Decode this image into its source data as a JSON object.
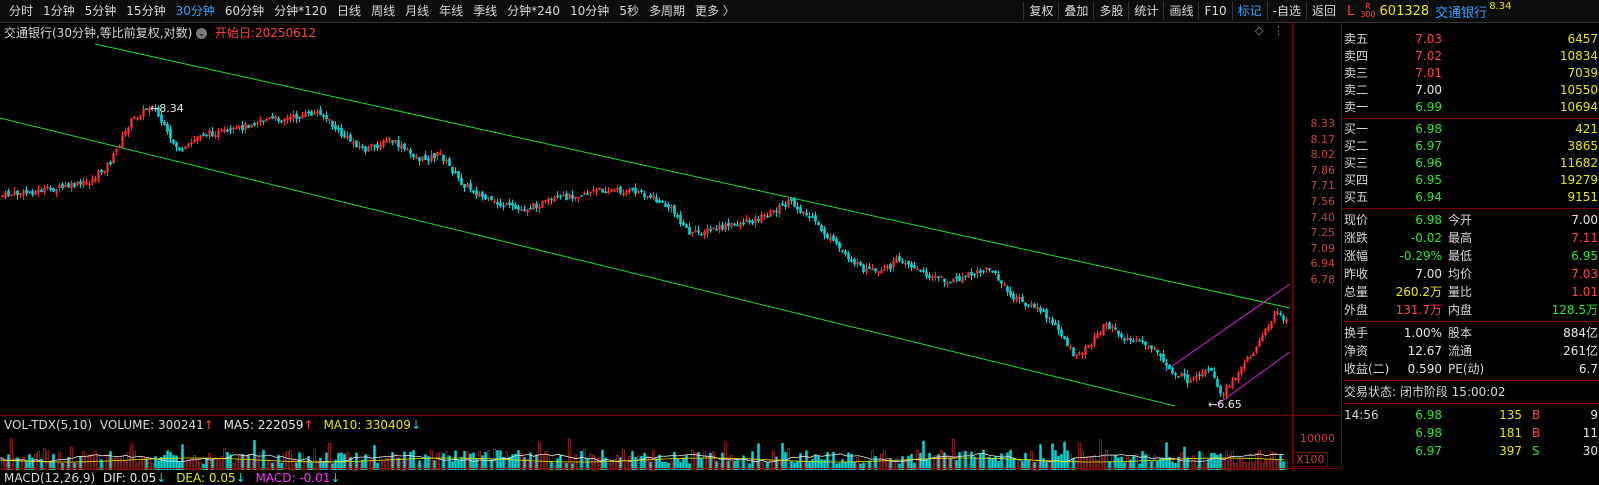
{
  "toolbar": {
    "periods": [
      "分时",
      "1分钟",
      "5分钟",
      "15分钟",
      "30分钟",
      "60分钟",
      "分钟*120",
      "日线",
      "周线",
      "月线",
      "年线",
      "季线",
      "分钟*240",
      "10分钟",
      "5秒",
      "多周期",
      "更多 〉"
    ],
    "active_period": "30分钟",
    "right_buttons": [
      "复权",
      "叠加",
      "多股",
      "统计",
      "画线",
      "F10",
      "标记",
      "-自选",
      "返回"
    ],
    "marked_button": "标记"
  },
  "stock": {
    "market_tag": "L",
    "r300": "R\n300",
    "code": "601328",
    "name": "交通银行",
    "price_small": "8.34"
  },
  "chart": {
    "title": "交通银行(30分钟,等比前复权,对数)",
    "start_label": "开始日:20250612",
    "y_ticks": [
      "8.33",
      "8.17",
      "8.02",
      "7.86",
      "7.71",
      "7.56",
      "7.40",
      "7.25",
      "7.09",
      "6.94",
      "6.78"
    ],
    "high_label": "8.34",
    "low_label": "6.65",
    "colors": {
      "up": "#ff3030",
      "down": "#00d8d8",
      "channel": "#22dd22",
      "channel2": "#dd22dd",
      "ma5": "#e8e8e8",
      "ma10": "#e8e800"
    }
  },
  "volume": {
    "indicator": "VOL-TDX(5,10)",
    "volume_label": "VOLUME: 300241",
    "ma5_label": "MA5: 222059",
    "ma10_label": "MA10: 330409",
    "y_tick": "10000",
    "unit": "X100"
  },
  "macd": {
    "indicator": "MACD(12,26,9)",
    "dif_label": "DIF: 0.05",
    "dea_label": "DEA: 0.05",
    "macd_label": "MACD: -0.01"
  },
  "order_book": {
    "asks": [
      {
        "label": "卖五",
        "price": "7.03",
        "vol": "6457"
      },
      {
        "label": "卖四",
        "price": "7.02",
        "vol": "10834"
      },
      {
        "label": "卖三",
        "price": "7.01",
        "vol": "7039"
      },
      {
        "label": "卖二",
        "price": "7.00",
        "vol": "10550"
      },
      {
        "label": "卖一",
        "price": "6.99",
        "vol": "10694"
      }
    ],
    "bids": [
      {
        "label": "买一",
        "price": "6.98",
        "vol": "421"
      },
      {
        "label": "买二",
        "price": "6.97",
        "vol": "3865"
      },
      {
        "label": "买三",
        "price": "6.96",
        "vol": "11682"
      },
      {
        "label": "买四",
        "price": "6.95",
        "vol": "19279"
      },
      {
        "label": "买五",
        "price": "6.94",
        "vol": "9151"
      }
    ]
  },
  "quote": {
    "rows": [
      {
        "l1": "现价",
        "v1": "6.98",
        "l2": "今开",
        "v2": "7.00"
      },
      {
        "l1": "涨跌",
        "v1": "-0.02",
        "l2": "最高",
        "v2": "7.11"
      },
      {
        "l1": "涨幅",
        "v1": "-0.29%",
        "l2": "最低",
        "v2": "6.95"
      },
      {
        "l1": "昨收",
        "v1": "7.00",
        "l2": "均价",
        "v2": "7.03"
      },
      {
        "l1": "总量",
        "v1": "260.2万",
        "l2": "量比",
        "v2": "1.01"
      },
      {
        "l1": "外盘",
        "v1": "131.7万",
        "l2": "内盘",
        "v2": "128.5万"
      }
    ],
    "rows2": [
      {
        "l1": "换手",
        "v1": "1.00%",
        "l2": "股本",
        "v2": "884亿"
      },
      {
        "l1": "净资",
        "v1": "12.67",
        "l2": "流通",
        "v2": "261亿"
      },
      {
        "l1": "收益(二)",
        "v1": "0.590",
        "l2": "PE(动)",
        "v2": "6.7"
      }
    ],
    "status_label": "交易状态: 闭市阶段 15:00:02"
  },
  "ticks": [
    {
      "time": "14:56",
      "price": "6.98",
      "vol": "135",
      "side": "B",
      "n": "9"
    },
    {
      "time": "",
      "price": "6.98",
      "vol": "181",
      "side": "B",
      "n": "11"
    },
    {
      "time": "",
      "price": "6.97",
      "vol": "397",
      "side": "S",
      "n": "30"
    }
  ]
}
